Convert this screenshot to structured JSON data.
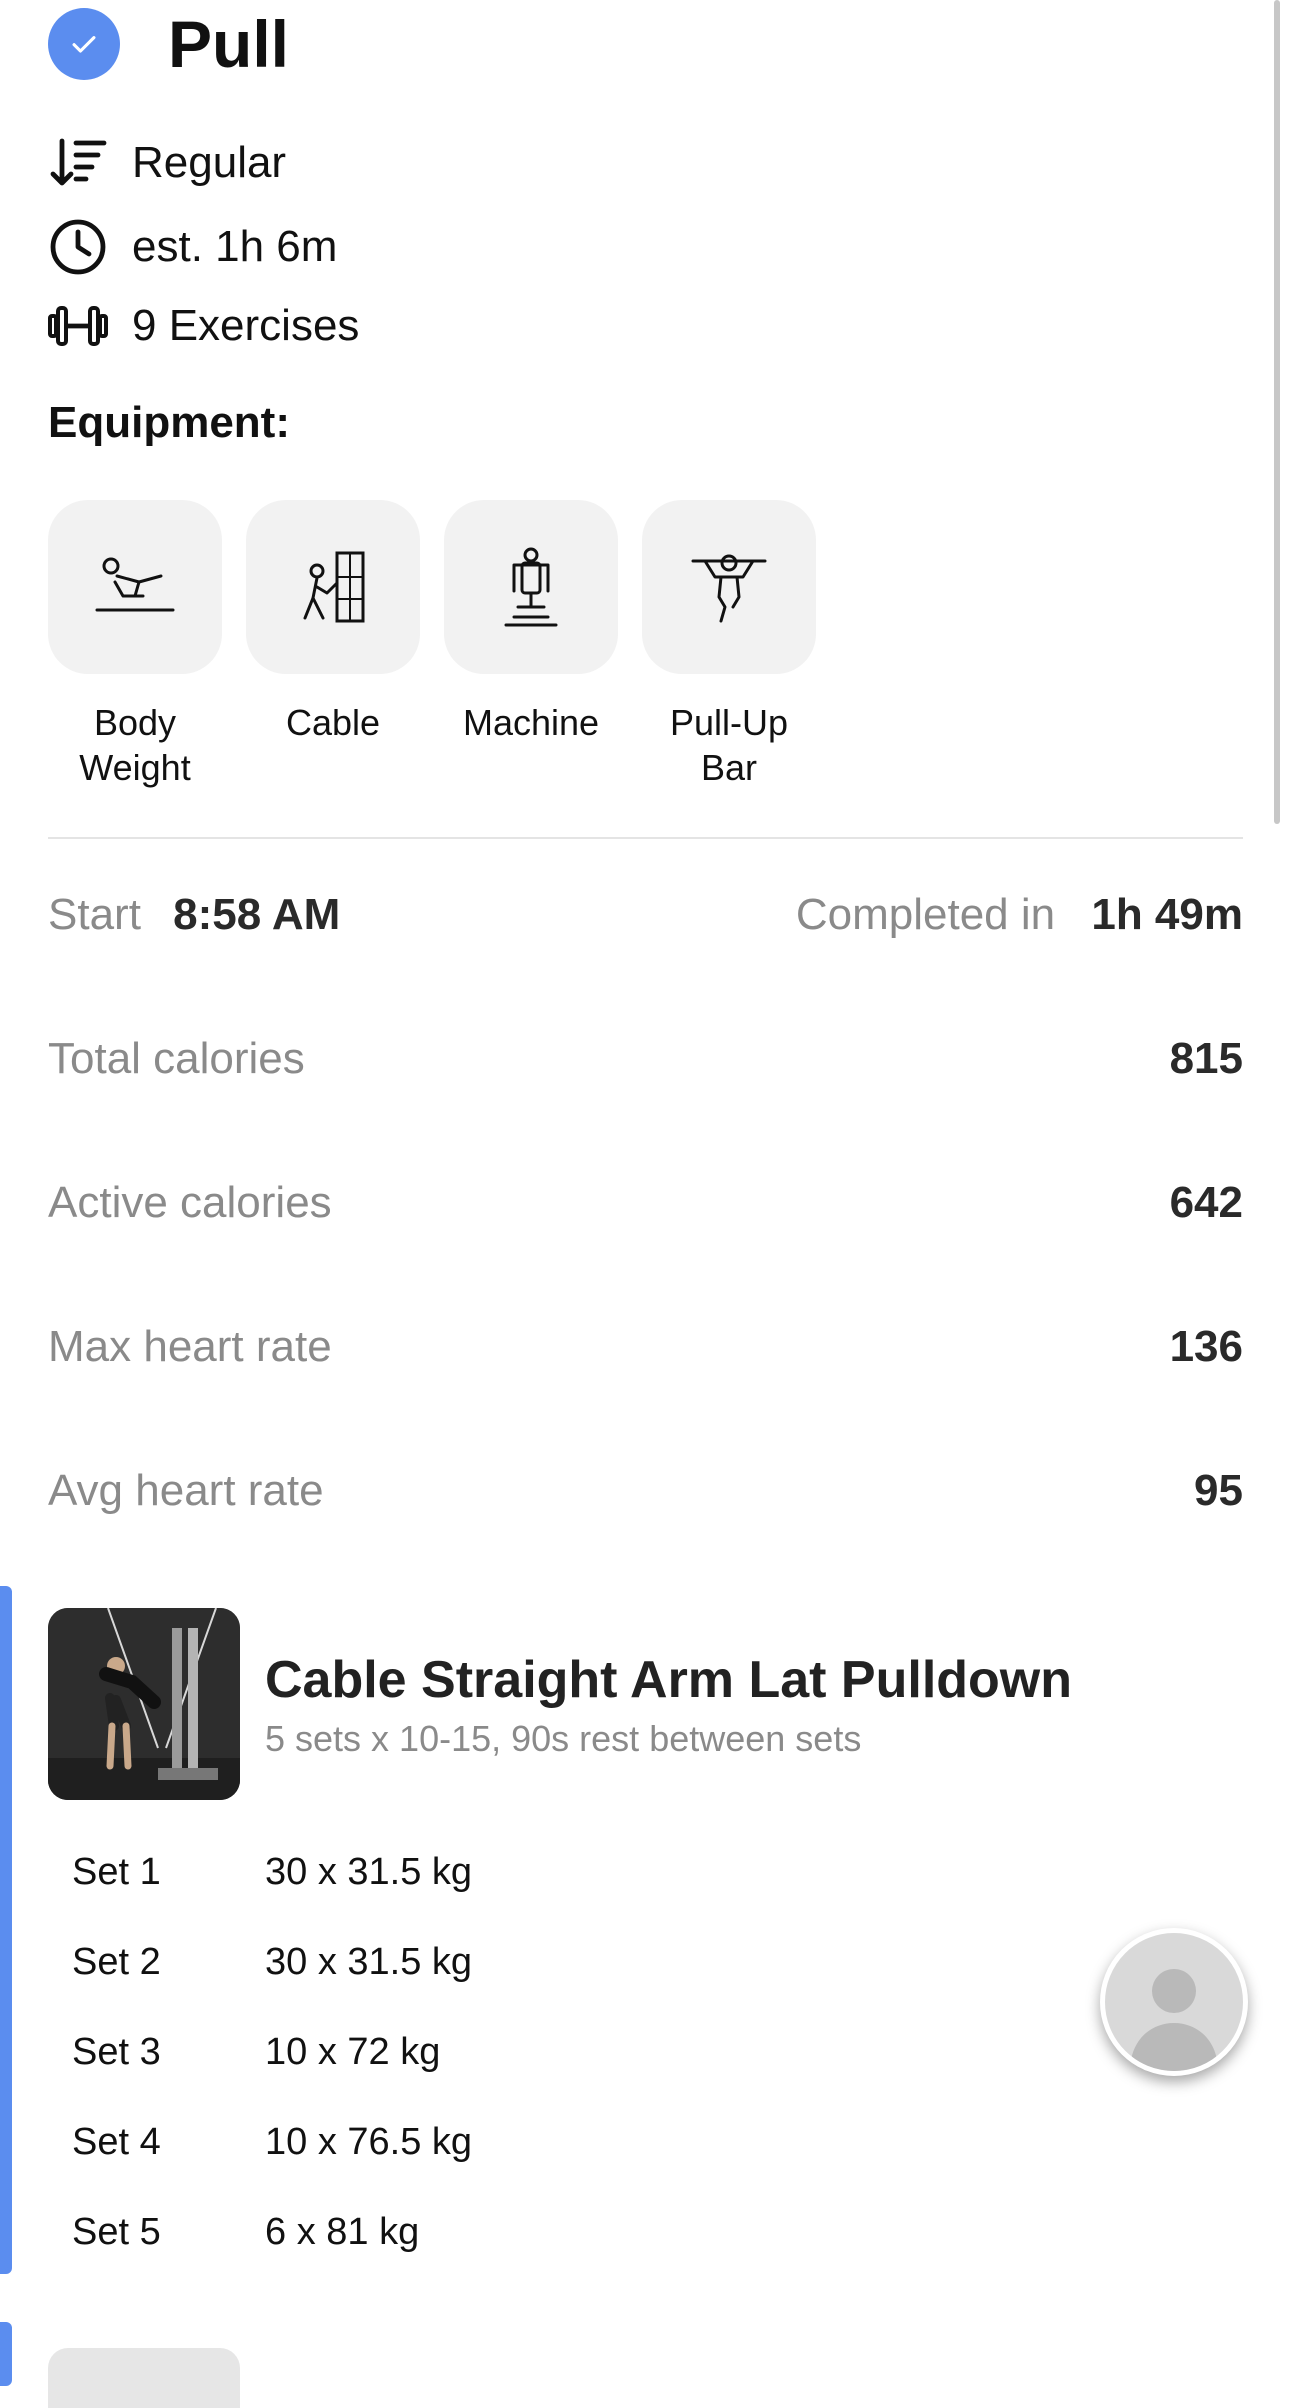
{
  "workout": {
    "title": "Pull",
    "type": "Regular",
    "estimate": "est. 1h 6m",
    "exercise_count": "9 Exercises"
  },
  "equipment": {
    "heading": "Equipment:",
    "items": [
      {
        "label": "Body\nWeight",
        "icon": "body-weight-icon"
      },
      {
        "label": "Cable",
        "icon": "cable-icon"
      },
      {
        "label": "Machine",
        "icon": "machine-icon"
      },
      {
        "label": "Pull-Up\nBar",
        "icon": "pull-up-bar-icon"
      }
    ]
  },
  "session": {
    "start_label": "Start",
    "start_value": "8:58 AM",
    "completed_label": "Completed in",
    "completed_value": "1h 49m"
  },
  "stats": [
    {
      "label": "Total calories",
      "value": "815"
    },
    {
      "label": "Active calories",
      "value": "642"
    },
    {
      "label": "Max heart rate",
      "value": "136"
    },
    {
      "label": "Avg heart rate",
      "value": "95"
    }
  ],
  "exercise": {
    "name": "Cable Straight Arm Lat Pulldown",
    "prescription": "5 sets x 10-15, 90s rest between sets",
    "sets": [
      {
        "label": "Set 1",
        "value": "30 x 31.5 kg"
      },
      {
        "label": "Set 2",
        "value": "30 x 31.5 kg"
      },
      {
        "label": "Set 3",
        "value": "10 x 72 kg"
      },
      {
        "label": "Set 4",
        "value": "10 x 76.5 kg"
      },
      {
        "label": "Set 5",
        "value": "6 x 81 kg"
      }
    ]
  },
  "colors": {
    "accent": "#5b8def",
    "muted_text": "#8a8a8a",
    "tile_bg": "#f2f2f2"
  }
}
